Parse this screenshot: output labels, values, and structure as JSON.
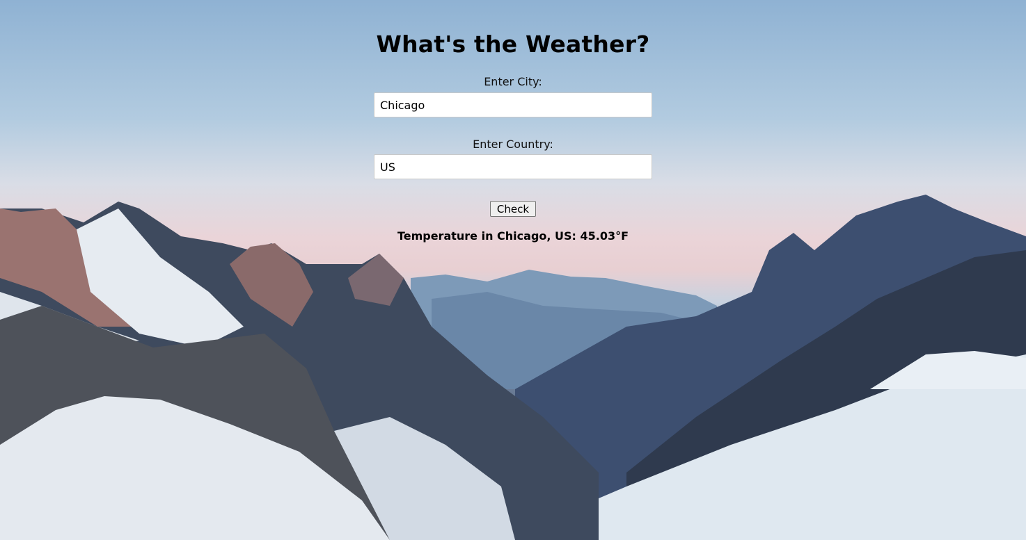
{
  "page": {
    "title": "What's the Weather?"
  },
  "form": {
    "city_label": "Enter City:",
    "city_value": "Chicago",
    "country_label": "Enter Country:",
    "country_value": "US",
    "check_label": "Check"
  },
  "result": {
    "text": "Temperature in Chicago, US: 45.03°F"
  },
  "background": {
    "description_icon": "mountain-landscape-icon",
    "sky_color": "#b2cbe0",
    "snow_color": "#e7edf3"
  }
}
